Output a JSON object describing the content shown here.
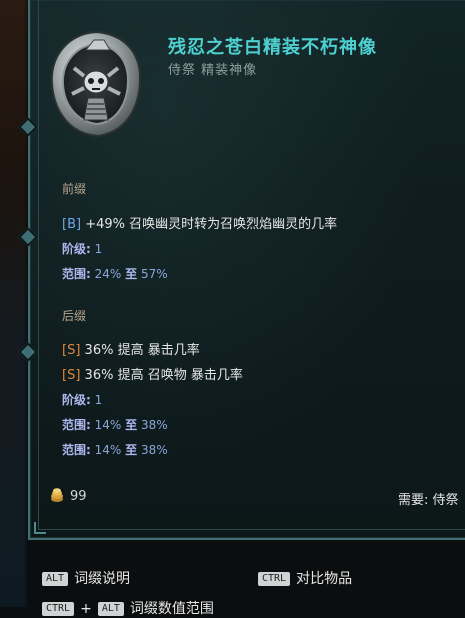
{
  "item": {
    "title": "残忍之苍白精装不朽神像",
    "subtitle": "侍祭 精装神像"
  },
  "prefix": {
    "label": "前缀",
    "affix_tag": "[B]",
    "affix_text": "+49% 召唤幽灵时转为召唤烈焰幽灵的几率",
    "tier_label": "阶级",
    "tier_value": "1",
    "range_label": "范围",
    "range_min": "24%",
    "range_to": "至",
    "range_max": "57%"
  },
  "suffix": {
    "label": "后缀",
    "affix1_tag": "[S]",
    "affix1_text": "36% 提高 暴击几率",
    "affix2_tag": "[S]",
    "affix2_text": "36% 提高 召唤物 暴击几率",
    "tier_label": "阶级",
    "tier_value": "1",
    "range1_label": "范围",
    "range1_min": "14%",
    "range1_to": "至",
    "range1_max": "38%",
    "range2_label": "范围",
    "range2_min": "14%",
    "range2_to": "至",
    "range2_max": "38%"
  },
  "footer": {
    "gold": "99",
    "requirement": "需要: 侍祭"
  },
  "hints": {
    "alt_key": "ALT",
    "alt_label": "词缀说明",
    "ctrl_key": "CTRL",
    "ctrl_label": "对比物品",
    "combo_key1": "CTRL",
    "combo_key2": "ALT",
    "combo_label": "词缀数值范围"
  },
  "colors": {
    "title": "#4fd0d0",
    "border": "#3f6f72",
    "tag_b": "#6fa8e8",
    "tag_s": "#e0863a"
  }
}
